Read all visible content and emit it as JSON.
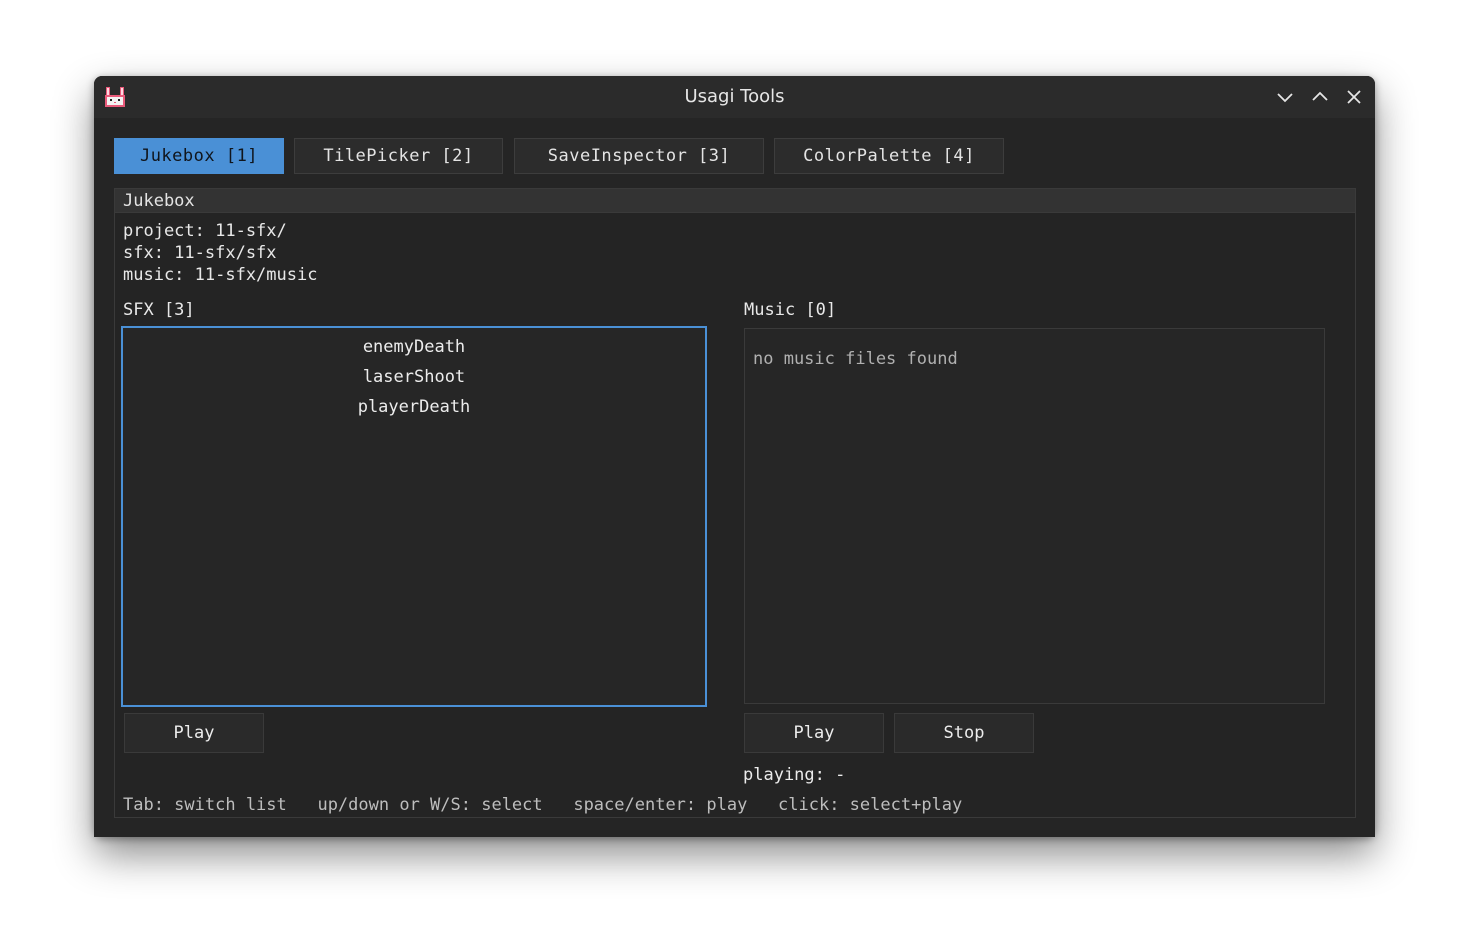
{
  "window": {
    "title": "Usagi Tools",
    "icon": "usagi-bunny-icon",
    "controls": [
      "minimize-icon",
      "maximize-icon",
      "close-icon"
    ]
  },
  "tabs": [
    {
      "label": "Jukebox [1]",
      "active": true
    },
    {
      "label": "TilePicker [2]",
      "active": false
    },
    {
      "label": "SaveInspector [3]",
      "active": false
    },
    {
      "label": "ColorPalette [4]",
      "active": false
    }
  ],
  "panel": {
    "title": "Jukebox",
    "project": "project: 11-sfx/",
    "sfx_path": "sfx: 11-sfx/sfx",
    "music_path": "music: 11-sfx/music"
  },
  "sfx": {
    "label": "SFX [3]",
    "items": [
      "enemyDeath",
      "laserShoot",
      "playerDeath"
    ],
    "play_label": "Play"
  },
  "music": {
    "label": "Music [0]",
    "empty_text": "no music files found",
    "play_label": "Play",
    "stop_label": "Stop"
  },
  "status": {
    "playing": "playing: -"
  },
  "help": "Tab: switch list   up/down or W/S: select   space/enter: play   click: select+play",
  "colors": {
    "accent": "#4a90d6",
    "background": "#242424",
    "titlebar": "#2b2b2b"
  }
}
